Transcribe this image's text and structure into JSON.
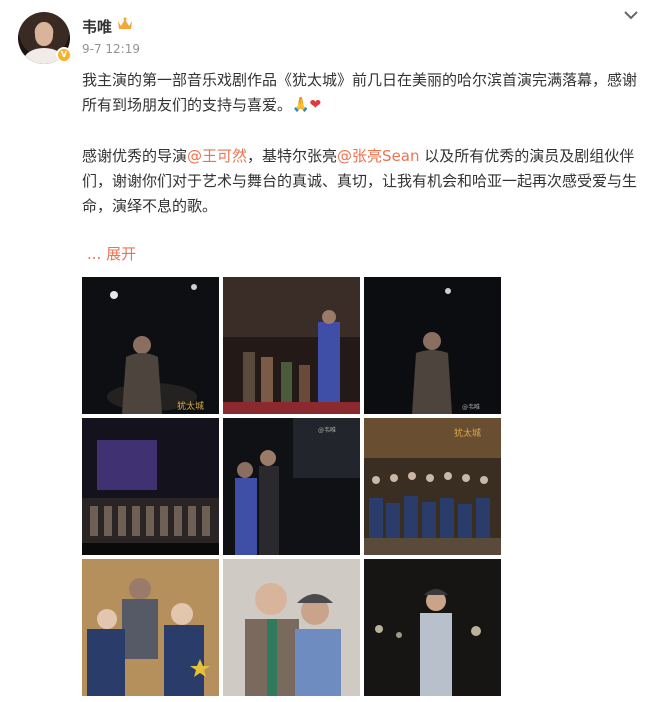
{
  "post": {
    "author": "韦唯",
    "timestamp": "9-7 12:19",
    "paragraph1": {
      "text": "我主演的第一部音乐戏剧作品《犹太城》前几日在美丽的哈尔滨首演完满落幕，感谢所有到场朋友们的支持与喜爱。",
      "emojis": [
        "🙏",
        "❤"
      ]
    },
    "paragraph2": {
      "prefix": "感谢优秀的导演",
      "mention1": "@王可然",
      "middle": "，基特尔张亮",
      "mention2": "@张亮Sean",
      "suffix": " 以及所有优秀的演员及剧组伙伴们，谢谢你们对于艺术与舞台的真诚、真切，让我有机会和哈亚一起再次感受爱与生命，演绎不息的歌。"
    },
    "more_label": "... 展开",
    "icons": {
      "verified": "verified-badge-icon",
      "crown": "crown-icon",
      "menu": "chevron-down-icon"
    },
    "photo_captions": {
      "poster_logo": "犹太城",
      "watermark": "@韦唯"
    },
    "colors": {
      "mention": "#eb7350",
      "timestamp": "#939393",
      "text": "#333333"
    }
  }
}
